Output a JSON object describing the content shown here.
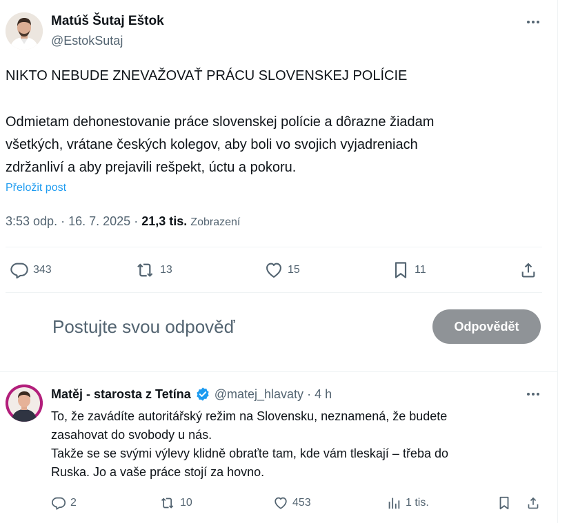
{
  "post": {
    "author_name": "Matúš Šutaj Eštok",
    "author_handle": "@EstokSutaj",
    "title": "NIKTO NEBUDE ZNEVAŽOVAŤ PRÁCU SLOVENSKEJ POLÍCIE",
    "body_lines": [
      "Odmietam dehonestovanie práce slovenskej polície a dôrazne žiadam",
      "všetkých, vrátane českých kolegov, aby boli vo svojich vyjadreniach",
      "zdržanliví a aby prejavili rešpekt, úctu a pokoru."
    ],
    "translate_link": "Přeložit post",
    "time": "3:53 odp.",
    "dot": "·",
    "date": "16. 7. 2025",
    "views_count": "21,3 tis.",
    "views_label": "Zobrazení",
    "actions": {
      "replies": "343",
      "reposts": "13",
      "likes": "15",
      "bookmarks": "11"
    }
  },
  "composer": {
    "placeholder": "Postujte svou odpověď",
    "reply_button": "Odpovědět"
  },
  "reply": {
    "author_name": "Matěj - starosta z Tetína",
    "author_handle": "@matej_hlavaty",
    "dot": "·",
    "time": "4 h",
    "text_lines": [
      "To, že zavádíte autoritářský režim na Slovensku, neznamená, že budete",
      "zasahovat do svobody u nás.",
      "Takže se se svými výlevy klidně obraťte tam, kde vám tleskají – třeba do",
      "Ruska. Jo a vaše práce stojí za hovno."
    ],
    "actions": {
      "replies": "2",
      "reposts": "10",
      "likes": "453",
      "views": "1 tis."
    }
  },
  "colors": {
    "text": "#0f1419",
    "secondary": "#536471",
    "link": "#1d9bf0",
    "verified": "#1d9bf0",
    "button_disabled": "#8f9397",
    "divider": "#eff3f4"
  },
  "icons": {
    "reply": "reply-icon",
    "repost": "repost-icon",
    "like": "heart-icon",
    "bookmark": "bookmark-icon",
    "share": "share-icon",
    "views": "views-icon",
    "more": "more-icon",
    "verified": "verified-badge-icon"
  }
}
